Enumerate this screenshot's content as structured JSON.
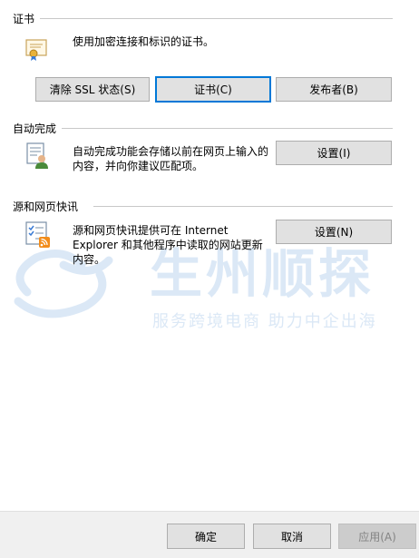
{
  "certificates": {
    "title": "证书",
    "description": "使用加密连接和标识的证书。",
    "clear_ssl_label": "清除 SSL 状态(S)",
    "certificates_label": "证书(C)",
    "publishers_label": "发布者(B)"
  },
  "autocomplete": {
    "title": "自动完成",
    "description_line1": "自动完成功能会存储以前在网页上输入的",
    "description_line2": "内容，并向你建议匹配项。",
    "settings_label": "设置(I)"
  },
  "feeds": {
    "title": "源和网页快讯",
    "description_line1": "源和网页快讯提供可在 Internet",
    "description_line2": "Explorer 和其他程序中读取的网站更新",
    "description_line3": "内容。",
    "settings_label": "设置(N)"
  },
  "watermark": {
    "brand": "生州顺探",
    "slogan": "服务跨境电商 助力中企出海"
  },
  "footer": {
    "ok_label": "确定",
    "cancel_label": "取消",
    "apply_label": "应用(A)"
  },
  "colors": {
    "focus_border": "#0078d7",
    "watermark": "#dbe8f6"
  }
}
